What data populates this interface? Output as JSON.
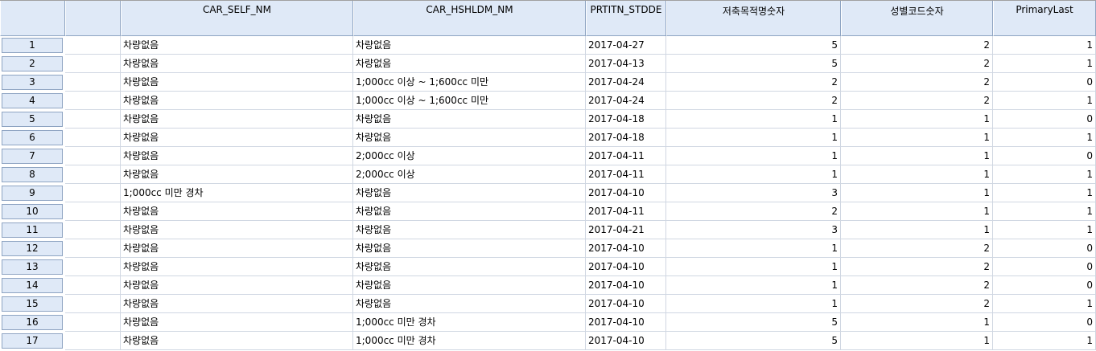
{
  "columns": [
    "CAR_SELF_NM",
    "CAR_HSHLDM_NM",
    "PRTITN_STDDE",
    "저축목적명숫자",
    "성별코드숫자",
    "PrimaryLast"
  ],
  "rows": [
    {
      "n": "1",
      "self": "차량없음",
      "hshld": "차량없음",
      "date": "2017-04-27",
      "purpose": "5",
      "gender": "2",
      "primary": "1"
    },
    {
      "n": "2",
      "self": "차량없음",
      "hshld": "차량없음",
      "date": "2017-04-13",
      "purpose": "5",
      "gender": "2",
      "primary": "1"
    },
    {
      "n": "3",
      "self": "차량없음",
      "hshld": "1;000cc 이상 ~ 1;600cc 미만",
      "date": "2017-04-24",
      "purpose": "2",
      "gender": "2",
      "primary": "0"
    },
    {
      "n": "4",
      "self": "차량없음",
      "hshld": "1;000cc 이상 ~ 1;600cc 미만",
      "date": "2017-04-24",
      "purpose": "2",
      "gender": "2",
      "primary": "1"
    },
    {
      "n": "5",
      "self": "차량없음",
      "hshld": "차량없음",
      "date": "2017-04-18",
      "purpose": "1",
      "gender": "1",
      "primary": "0"
    },
    {
      "n": "6",
      "self": "차량없음",
      "hshld": "차량없음",
      "date": "2017-04-18",
      "purpose": "1",
      "gender": "1",
      "primary": "1"
    },
    {
      "n": "7",
      "self": "차량없음",
      "hshld": "2;000cc 이상",
      "date": "2017-04-11",
      "purpose": "1",
      "gender": "1",
      "primary": "0"
    },
    {
      "n": "8",
      "self": "차량없음",
      "hshld": "2;000cc 이상",
      "date": "2017-04-11",
      "purpose": "1",
      "gender": "1",
      "primary": "1"
    },
    {
      "n": "9",
      "self": "1;000cc 미만 경차",
      "hshld": "차량없음",
      "date": "2017-04-10",
      "purpose": "3",
      "gender": "1",
      "primary": "1"
    },
    {
      "n": "10",
      "self": "차량없음",
      "hshld": "차량없음",
      "date": "2017-04-11",
      "purpose": "2",
      "gender": "1",
      "primary": "1"
    },
    {
      "n": "11",
      "self": "차량없음",
      "hshld": "차량없음",
      "date": "2017-04-21",
      "purpose": "3",
      "gender": "1",
      "primary": "1"
    },
    {
      "n": "12",
      "self": "차량없음",
      "hshld": "차량없음",
      "date": "2017-04-10",
      "purpose": "1",
      "gender": "2",
      "primary": "0"
    },
    {
      "n": "13",
      "self": "차량없음",
      "hshld": "차량없음",
      "date": "2017-04-10",
      "purpose": "1",
      "gender": "2",
      "primary": "0"
    },
    {
      "n": "14",
      "self": "차량없음",
      "hshld": "차량없음",
      "date": "2017-04-10",
      "purpose": "1",
      "gender": "2",
      "primary": "0"
    },
    {
      "n": "15",
      "self": "차량없음",
      "hshld": "차량없음",
      "date": "2017-04-10",
      "purpose": "1",
      "gender": "2",
      "primary": "1"
    },
    {
      "n": "16",
      "self": "차량없음",
      "hshld": "1;000cc 미만 경차",
      "date": "2017-04-10",
      "purpose": "5",
      "gender": "1",
      "primary": "0"
    },
    {
      "n": "17",
      "self": "차량없음",
      "hshld": "1;000cc 미만 경차",
      "date": "2017-04-10",
      "purpose": "5",
      "gender": "1",
      "primary": "1"
    }
  ]
}
